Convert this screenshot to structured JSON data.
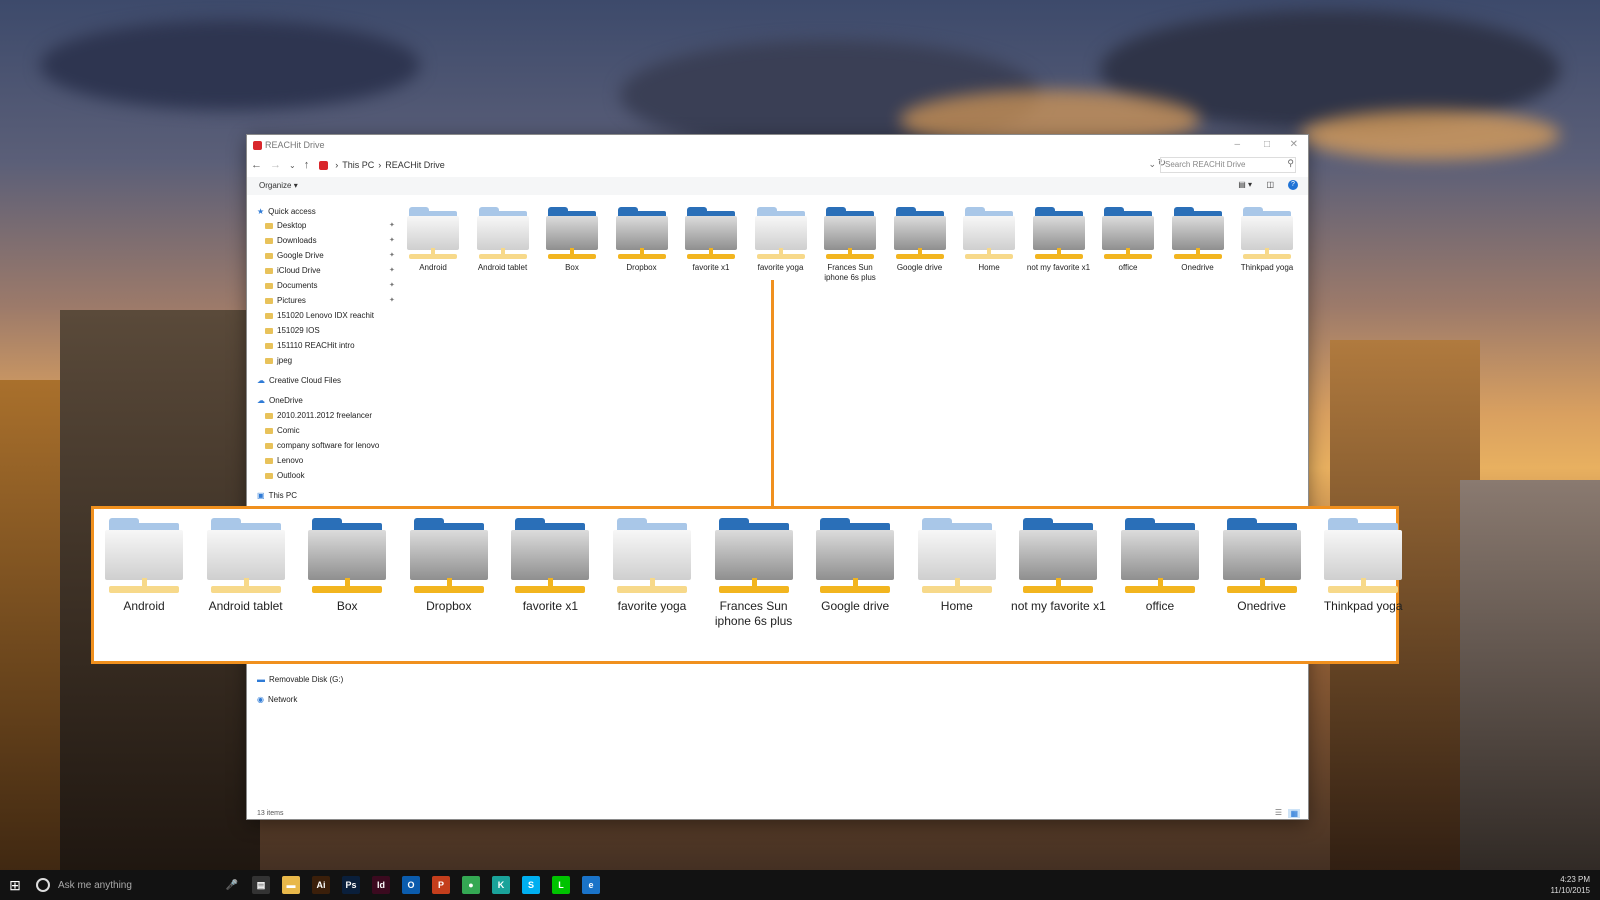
{
  "window": {
    "title": "REACHit Drive",
    "breadcrumb": [
      "This PC",
      "REACHit Drive"
    ],
    "search_placeholder": "Search REACHit Drive",
    "organize_label": "Organize",
    "status": "13 items"
  },
  "sidebar": {
    "items": [
      {
        "label": "Quick access",
        "pinned": false
      },
      {
        "label": "Desktop",
        "pinned": true
      },
      {
        "label": "Downloads",
        "pinned": true
      },
      {
        "label": "Google Drive",
        "pinned": true
      },
      {
        "label": "iCloud Drive",
        "pinned": true
      },
      {
        "label": "Documents",
        "pinned": true
      },
      {
        "label": "Pictures",
        "pinned": true
      },
      {
        "label": "151020 Lenovo IDX reachit",
        "pinned": false
      },
      {
        "label": "151029 IOS",
        "pinned": false
      },
      {
        "label": "151110 REACHit intro",
        "pinned": false
      },
      {
        "label": "jpeg",
        "pinned": false
      },
      {
        "label": "Creative Cloud Files",
        "pinned": false
      },
      {
        "label": "OneDrive",
        "pinned": false
      },
      {
        "label": "2010.2011.2012 freelancer",
        "pinned": false
      },
      {
        "label": "Comic",
        "pinned": false
      },
      {
        "label": "company software for lenovo",
        "pinned": false
      },
      {
        "label": "Lenovo",
        "pinned": false
      },
      {
        "label": "Outlook",
        "pinned": false
      },
      {
        "label": "This PC",
        "pinned": false
      },
      {
        "label": "Removable Disk (G:)",
        "pinned": false
      },
      {
        "label": "Network",
        "pinned": false
      }
    ]
  },
  "folders": [
    {
      "name": "Android",
      "style": "light"
    },
    {
      "name": "Android tablet",
      "style": "light"
    },
    {
      "name": "Box",
      "style": "dark"
    },
    {
      "name": "Dropbox",
      "style": "dark"
    },
    {
      "name": "favorite x1",
      "style": "dark"
    },
    {
      "name": "favorite yoga",
      "style": "light"
    },
    {
      "name": "Frances Sun iphone 6s plus",
      "style": "dark"
    },
    {
      "name": "Google drive",
      "style": "dark"
    },
    {
      "name": "Home",
      "style": "light"
    },
    {
      "name": "not my favorite x1",
      "style": "dark"
    },
    {
      "name": "office",
      "style": "dark"
    },
    {
      "name": "Onedrive",
      "style": "dark"
    },
    {
      "name": "Thinkpad yoga",
      "style": "light"
    }
  ],
  "taskbar": {
    "search_placeholder": "Ask me anything",
    "time": "4:23 PM",
    "date": "11/10/2015",
    "apps": [
      "task-view",
      "file-explorer",
      "illustrator",
      "photoshop",
      "indesign",
      "outlook",
      "powerpoint",
      "chrome",
      "kaspersky",
      "skype",
      "line",
      "edge"
    ]
  },
  "colors": {
    "accent_orange": "#f0901e",
    "folder_blue": "#2a6fb8",
    "drive_yellow": "#f2b51f"
  }
}
